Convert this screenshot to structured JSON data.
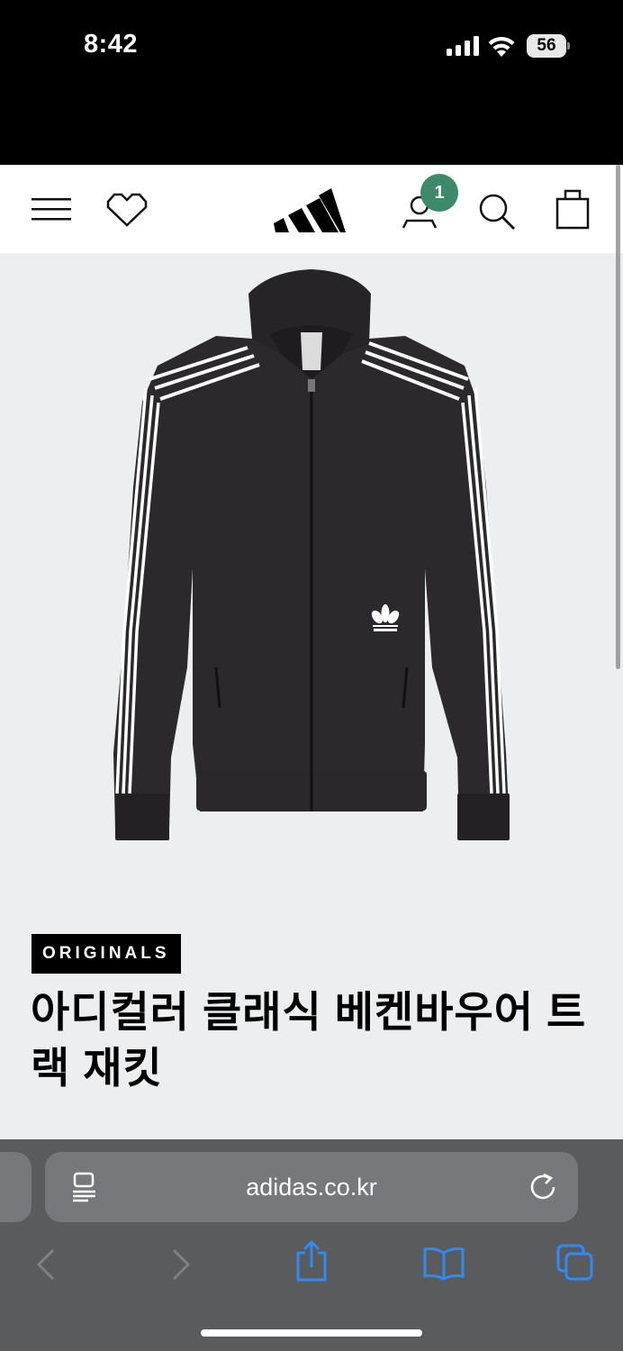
{
  "status": {
    "time": "8:42",
    "battery": "56"
  },
  "nav": {
    "account_badge_count": "1",
    "badge_color": "#3d8a6a"
  },
  "product": {
    "brand_badge": "ORIGINALS",
    "title": "아디컬러 클래식 베켄바우어 트랙 재킷"
  },
  "browser": {
    "url": "adidas.co.kr"
  }
}
